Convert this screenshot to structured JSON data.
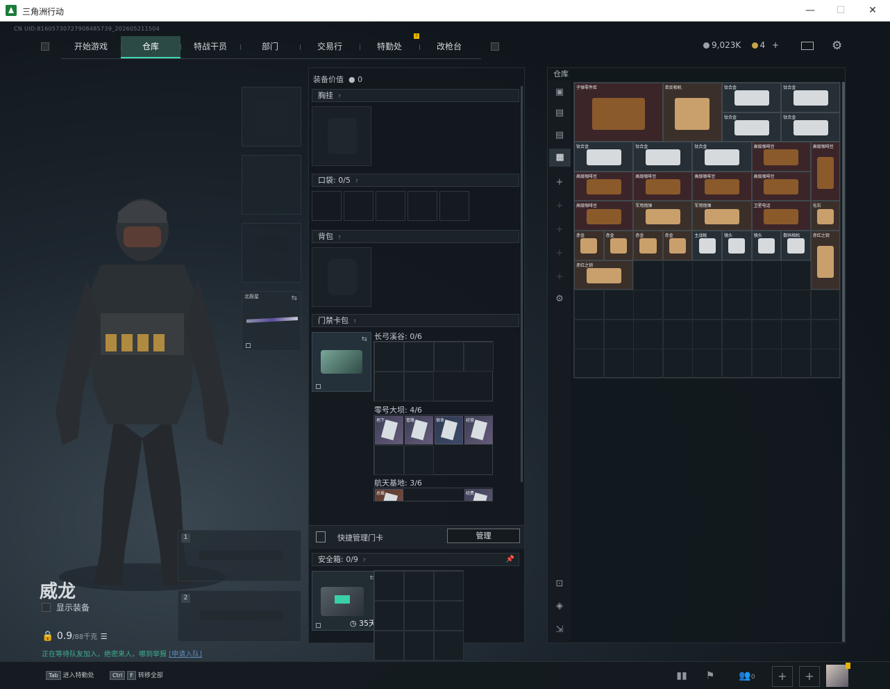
{
  "window": {
    "title": "三角洲行动",
    "minimize": "—",
    "maximize": "☐",
    "close": "✕"
  },
  "uid": "CN UID:8160573072790848573­9_2026052115​04",
  "nav": {
    "tabs": [
      "开始游戏",
      "仓库",
      "特战干员",
      "部门",
      "交易行",
      "特勤处",
      "改枪台"
    ],
    "active": 1
  },
  "currency": {
    "silver": "9,023K",
    "gold": "4",
    "plus": "+"
  },
  "operator": {
    "name": "威龙",
    "show_equip": "显示装备",
    "weight_value": "0.9",
    "weight_max": "/88千克",
    "notice": "正在等待队友加入，绝密来人，哪到举报",
    "notice_link": "[申请入队]"
  },
  "melee_label": "北极星",
  "weapon_slots": [
    "1",
    "2"
  ],
  "midpanel": {
    "equip_value_label": "装备价值",
    "equip_value": "0",
    "chest_rig": "胸挂",
    "pocket": "口袋: 0/5",
    "backpack": "背包",
    "keycard_bag": "门禁卡包",
    "maps": [
      "长弓溪谷: 0/6",
      "零号大坝: 4/6",
      "航天基地: 3/6"
    ],
    "dam_cards": [
      "地下",
      "管路",
      "宿舍",
      "经营"
    ],
    "space_cards": [
      "总裁",
      "经费"
    ],
    "quick_manage": "快捷管理门卡",
    "manage_btn": "管理",
    "safebox": "安全箱: 0/9",
    "safebox_days": "35天"
  },
  "storage": {
    "title": "仓库",
    "items": [
      {
        "name": "子弹零件库",
        "color": "red"
      },
      {
        "name": "单反相机",
        "color": "brown"
      },
      {
        "name": "钛合金",
        "color": "dark"
      },
      {
        "name": "钛合金",
        "color": "dark"
      },
      {
        "name": "钛合金",
        "color": "dark"
      },
      {
        "name": "钛合金",
        "color": "dark"
      },
      {
        "name": "钛合金",
        "color": "dark"
      },
      {
        "name": "钛合金",
        "color": "dark"
      },
      {
        "name": "钛合金",
        "color": "dark"
      },
      {
        "name": "高级咖啡豆",
        "color": "red"
      },
      {
        "name": "高级咖啡豆",
        "color": "red"
      },
      {
        "name": "高级咖啡豆",
        "color": "red"
      },
      {
        "name": "高级咖啡豆",
        "color": "red"
      },
      {
        "name": "高级咖啡豆",
        "color": "red"
      },
      {
        "name": "高级咖啡豆",
        "color": "red"
      },
      {
        "name": "高级咖啡豆",
        "color": "red"
      },
      {
        "name": "军用炮弹",
        "color": "brown"
      },
      {
        "name": "军用炮弹",
        "color": "brown"
      },
      {
        "name": "卫星电话",
        "color": "red"
      },
      {
        "name": "化石",
        "color": "brown"
      },
      {
        "name": "赤金",
        "color": "brown"
      },
      {
        "name": "赤金",
        "color": "brown"
      },
      {
        "name": "赤金",
        "color": "brown"
      },
      {
        "name": "赤金",
        "color": "brown"
      },
      {
        "name": "主战板",
        "color": "dark"
      },
      {
        "name": "镜头",
        "color": "dark"
      },
      {
        "name": "镜头",
        "color": "dark"
      },
      {
        "name": "数码相机",
        "color": "dark"
      },
      {
        "name": "赤红之钥",
        "color": "brown"
      },
      {
        "name": "赤红之钥",
        "color": "brown"
      }
    ]
  },
  "bottombar": {
    "hint1_key": "Tab",
    "hint1": "进入特勤处",
    "hint2_key1": "Ctrl",
    "hint2_key2": "F",
    "hint2": "转移全部",
    "friends": "0"
  }
}
